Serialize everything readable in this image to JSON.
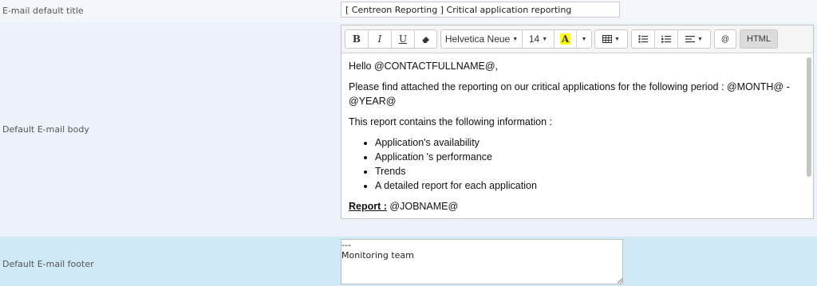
{
  "title_row": {
    "label": "E-mail default title",
    "value": "[ Centreon Reporting ] Critical application reporting"
  },
  "body_row": {
    "label": "Default E-mail body",
    "toolbar": {
      "bold": "B",
      "italic": "I",
      "underline": "U",
      "font_family": "Helvetica Neue",
      "font_size": "14",
      "color_label": "A",
      "html": "HTML",
      "at": "@"
    },
    "content": {
      "greeting": "Hello @CONTACTFULLNAME@,",
      "para1": "Please find attached the reporting on our critical applications for the following period : @MONTH@ - @YEAR@",
      "para2": "This report contains the following information :",
      "bullets": [
        "Application's availability",
        "Application 's performance",
        "Trends",
        "A detailed report for each application"
      ],
      "report_label": "Report :",
      "report_value": "@JOBNAME@"
    }
  },
  "footer_row": {
    "label": "Default E-mail footer",
    "value": "---\nMonitoring team"
  }
}
